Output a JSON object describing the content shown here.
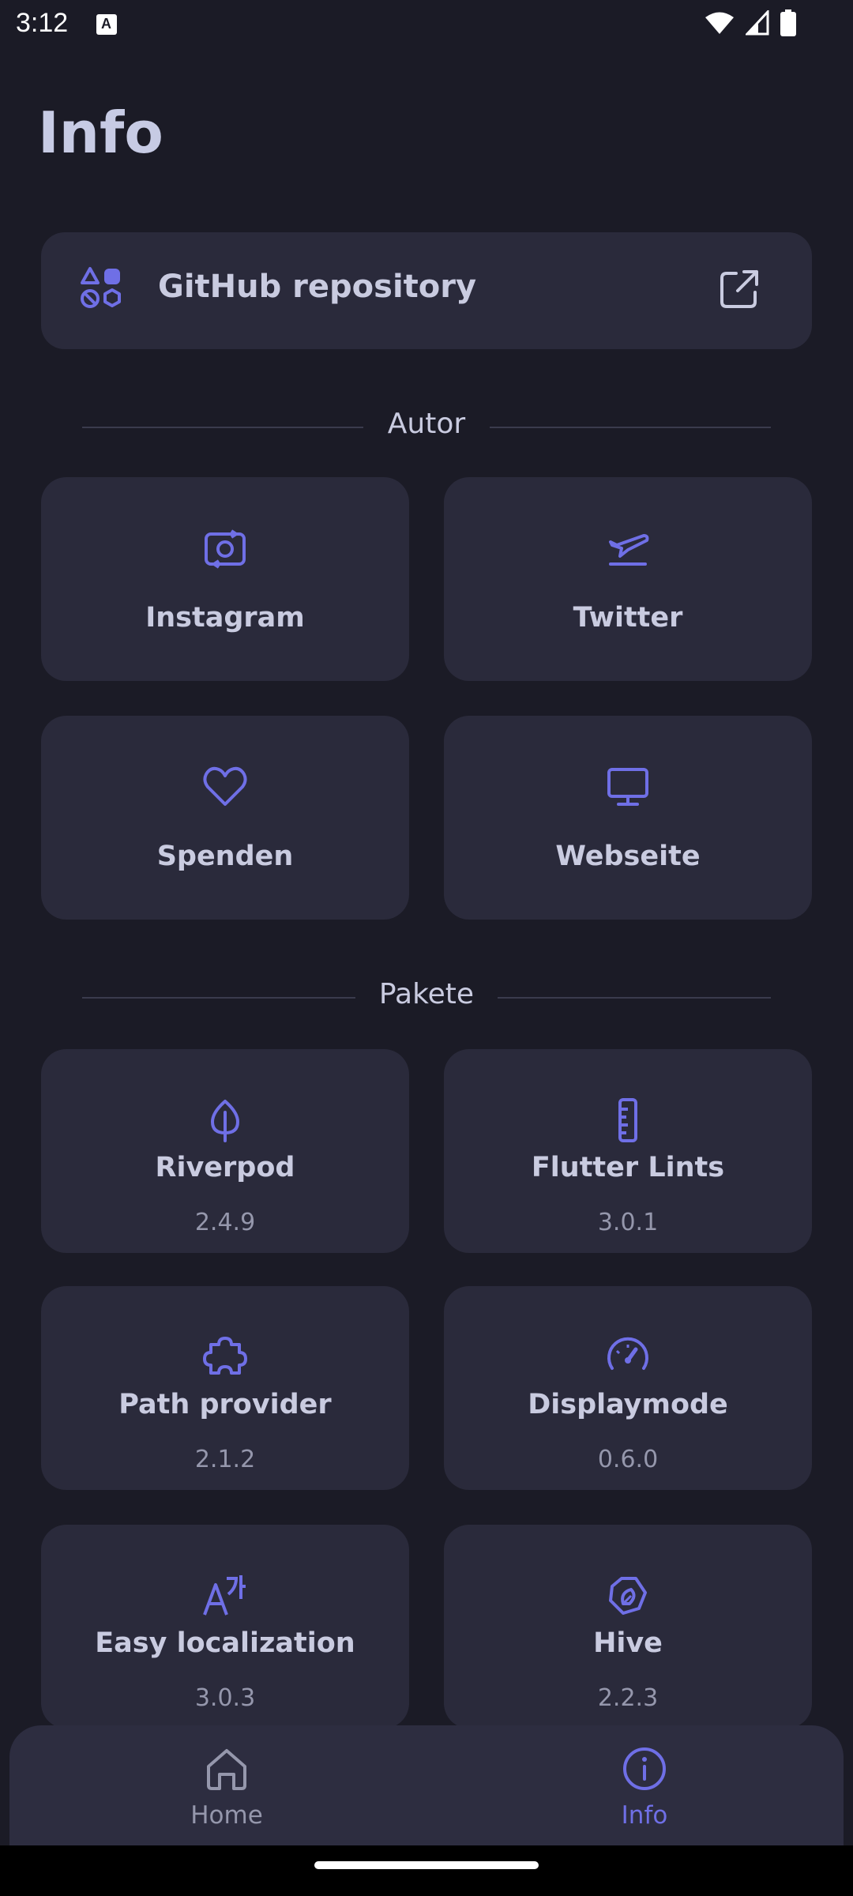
{
  "status_bar": {
    "time": "3:12",
    "notification_badge": "A"
  },
  "page": {
    "title": "Info"
  },
  "github": {
    "label": "GitHub repository"
  },
  "sections": {
    "author": "Autor",
    "packages": "Pakete"
  },
  "author_links": [
    {
      "label": "Instagram",
      "icon": "camera-rotate-icon"
    },
    {
      "label": "Twitter",
      "icon": "paper-plane-icon"
    },
    {
      "label": "Spenden",
      "icon": "heart-icon"
    },
    {
      "label": "Webseite",
      "icon": "monitor-icon"
    }
  ],
  "packages": [
    {
      "name": "Riverpod",
      "version": "2.4.9",
      "icon": "leaf-icon"
    },
    {
      "name": "Flutter Lints",
      "version": "3.0.1",
      "icon": "ruler-icon"
    },
    {
      "name": "Path provider",
      "version": "2.1.2",
      "icon": "puzzle-icon"
    },
    {
      "name": "Displaymode",
      "version": "0.6.0",
      "icon": "gauge-icon"
    },
    {
      "name": "Easy localization",
      "version": "3.0.3",
      "icon": "translate-icon"
    },
    {
      "name": "Hive",
      "version": "2.2.3",
      "icon": "plant-icon"
    }
  ],
  "bottom_nav": {
    "home_label": "Home",
    "info_label": "Info",
    "active": "Info"
  },
  "colors": {
    "background": "#1b1b26",
    "card": "#2a2a3b",
    "accent": "#6f6fe6",
    "text": "#c9cbe0",
    "muted": "#9597ac"
  }
}
